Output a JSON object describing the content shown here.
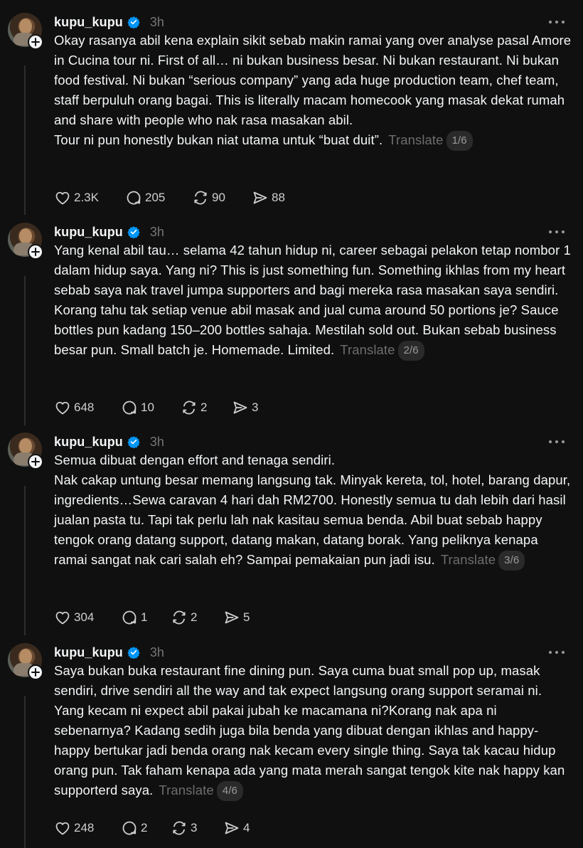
{
  "posts": [
    {
      "username": "kupu_kupu",
      "time": "3h",
      "text": "Okay rasanya abil kena explain sikit sebab makin ramai yang over analyse pasal Amore in Cucina tour ni. First of all… ni bukan business besar. Ni bukan restaurant. Ni bukan food festival. Ni bukan “serious company” yang ada huge production team, chef team, staff berpuluh orang bagai. This is literally macam homecook yang masak dekat rumah and share with people who nak rasa masakan abil.\nTour ni pun honestly bukan niat utama untuk “buat duit”.",
      "translate": "Translate",
      "page": "1/6",
      "likes": "2.3K",
      "replies": "205",
      "reposts": "90",
      "shares": "88"
    },
    {
      "username": "kupu_kupu",
      "time": "3h",
      "text": "Yang kenal abil tau… selama 42 tahun hidup ni, career sebagai pelakon tetap nombor 1 dalam hidup saya. Yang ni? This is just something fun. Something ikhlas from my heart sebab saya nak travel jumpa supporters and bagi mereka rasa masakan saya sendiri. Korang tahu tak setiap venue abil masak and jual cuma around 50 portions je? Sauce bottles pun kadang 150–200 bottles sahaja. Mestilah sold out. Bukan sebab business besar pun. Small batch je. Homemade. Limited.",
      "translate": "Translate",
      "page": "2/6",
      "likes": "648",
      "replies": "10",
      "reposts": "2",
      "shares": "3"
    },
    {
      "username": "kupu_kupu",
      "time": "3h",
      "text": "Semua dibuat dengan effort and tenaga sendiri.\nNak cakap untung besar memang langsung tak. Minyak kereta, tol, hotel, barang dapur, ingredients…Sewa caravan 4 hari dah RM2700. Honestly semua tu dah lebih dari hasil jualan pasta tu. Tapi tak perlu lah nak kasitau semua benda. Abil buat sebab happy tengok orang datang support, datang makan, datang borak. Yang peliknya kenapa ramai sangat nak cari salah eh? Sampai pemakaian pun jadi isu.",
      "translate": "Translate",
      "page": "3/6",
      "likes": "304",
      "replies": "1",
      "reposts": "2",
      "shares": "5"
    },
    {
      "username": "kupu_kupu",
      "time": "3h",
      "text": "Saya bukan buka restaurant fine dining pun. Saya cuma buat small pop up, masak sendiri, drive sendiri all the way and tak expect langsung orang support seramai ni. Yang kecam ni expect abil pakai jubah ke macamana ni?Korang nak apa ni sebenarnya? Kadang sedih juga bila benda yang dibuat dengan ikhlas and happy-happy bertukar jadi benda orang nak kecam every single thing. Saya tak kacau hidup orang pun. Tak faham kenapa ada yang mata merah sangat tengok kite nak happy kan supporterd saya.",
      "translate": "Translate",
      "page": "4/6",
      "likes": "248",
      "replies": "2",
      "reposts": "3",
      "shares": "4"
    }
  ],
  "colors": {
    "background": "#101010",
    "text": "#f3f5f7",
    "muted": "#777777",
    "verified": "#0095f6"
  },
  "icons": [
    "verified-badge-icon",
    "plus-icon",
    "more-icon",
    "heart-icon",
    "reply-icon",
    "repost-icon",
    "share-icon"
  ]
}
